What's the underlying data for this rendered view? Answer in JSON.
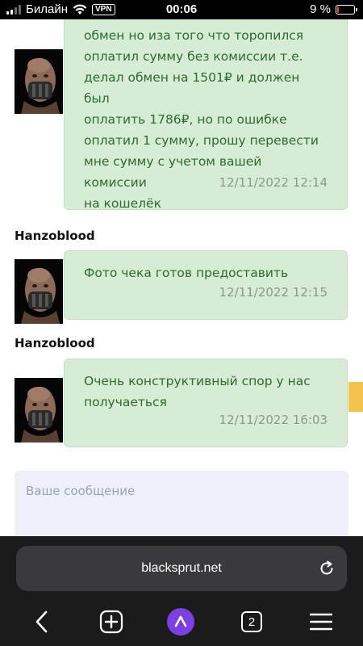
{
  "status_bar": {
    "carrier": "Билайн",
    "vpn": "VPN",
    "time": "00:06",
    "battery_percent": "9 %",
    "battery_level": 0.09,
    "battery_color": "#ff3b30"
  },
  "chat": {
    "messages": [
      {
        "author": "",
        "lines": [
          "обмен но иза того что торопился",
          "оплатил сумму без комиссии т.е.",
          "делал обмен на 1501₽ и должен был",
          "оплатить 1786₽, но по ошибке",
          "оплатил 1 сумму, прошу перевести",
          "мне сумму с учетом вашей комиссии",
          "на кошелёк"
        ],
        "timestamp": "12/11/2022 12:14"
      },
      {
        "author": "Hanzoblood",
        "lines": [
          "Фото чека готов предоставить"
        ],
        "timestamp": "12/11/2022 12:15"
      },
      {
        "author": "Hanzoblood",
        "lines": [
          "Очень конструктивный спор у нас",
          "получаеться"
        ],
        "timestamp": "12/11/2022 16:03"
      }
    ],
    "input_placeholder": "Ваше сообщение",
    "bubble_color": "#d6ecd5",
    "text_color": "#2f6b2c"
  },
  "browser": {
    "url": "blacksprut.net",
    "tabs_count": "2",
    "icons": [
      "back-arrow-icon",
      "new-tab-plus-icon",
      "alice-assistant-icon",
      "tabs-count-icon",
      "menu-hamburger-icon",
      "reload-icon"
    ]
  }
}
